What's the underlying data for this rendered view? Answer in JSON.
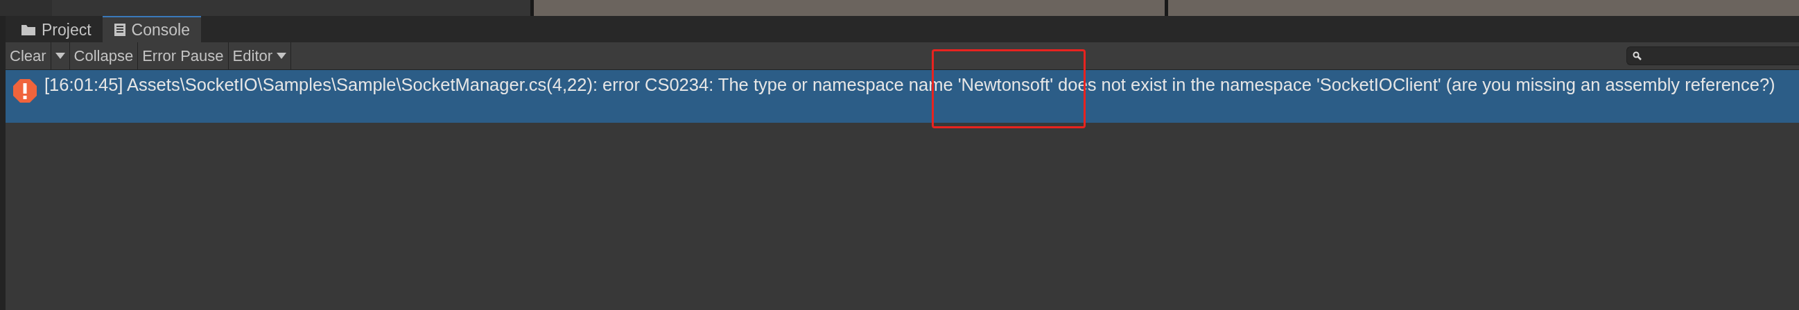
{
  "tabs": [
    {
      "label": "Project",
      "kind": "folder",
      "selected": false
    },
    {
      "label": "Console",
      "kind": "console",
      "selected": true
    }
  ],
  "toolbar": [
    {
      "label": "Clear",
      "kind": "split"
    },
    {
      "label": "Collapse",
      "kind": "toggle",
      "on": false
    },
    {
      "label": "Error Pause",
      "kind": "toggle",
      "on": false
    },
    {
      "label": "Editor",
      "kind": "dropdown"
    }
  ],
  "messages": [
    {
      "kind": "error",
      "selected": true,
      "text": "[16:01:45] Assets\\SocketIO\\Samples\\Sample\\SocketManager.cs(4,22): error CS0234: The type or namespace name 'Newtonsoft' does not exist in the namespace 'SocketIOClient' (are you missing an assembly reference?)"
    }
  ]
}
